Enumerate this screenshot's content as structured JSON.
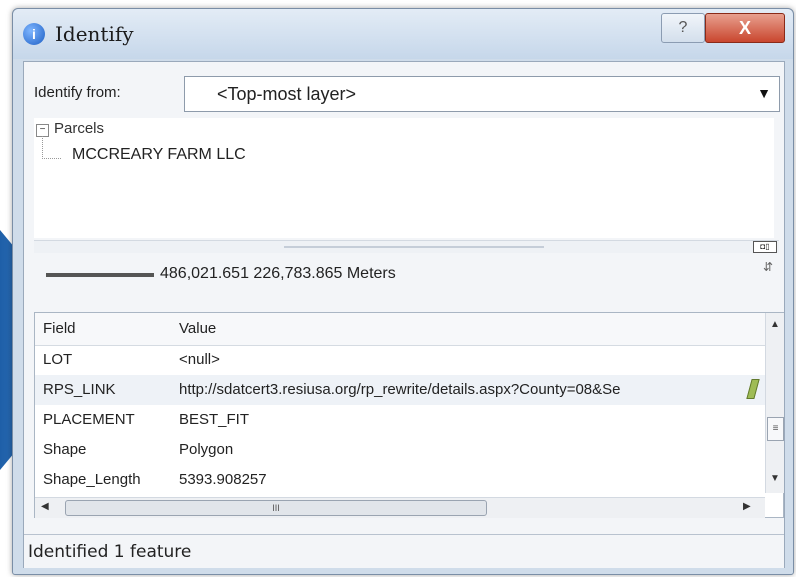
{
  "window": {
    "title": "Identify",
    "help_label": "?",
    "close_label": "X"
  },
  "identify_from": {
    "label": "Identify from:",
    "selected_value": "<Top-most layer>"
  },
  "tree": {
    "layer_name": "Parcels",
    "toggle": "−",
    "feature_name": "MCCREARY FARM LLC"
  },
  "splitter": {
    "icon": "◘▯"
  },
  "location": {
    "coordinates": "486,021.651  226,783.865 Meters"
  },
  "attributes": {
    "headers": {
      "field": "Field",
      "value": "Value"
    },
    "rows": [
      {
        "field": "LOT",
        "value": "<null>"
      },
      {
        "field": "RPS_LINK",
        "value": "http://sdatcert3.resiusa.org/rp_rewrite/details.aspx?County=08&Se"
      },
      {
        "field": "PLACEMENT",
        "value": "BEST_FIT"
      },
      {
        "field": "Shape",
        "value": "Polygon"
      },
      {
        "field": "Shape_Length",
        "value": "5393.908257"
      }
    ]
  },
  "scrollbar_glyphs": {
    "v_up": "▲",
    "v_down": "▼",
    "v_thumb": "≡",
    "h_left": "◀",
    "h_right": "▶",
    "h_thumb": "III"
  },
  "status": {
    "text": "Identified 1 feature"
  },
  "colors": {
    "title_bar": "#c6d7ea",
    "close_button": "#c9462e",
    "panel_bg": "#f3f5f8"
  }
}
